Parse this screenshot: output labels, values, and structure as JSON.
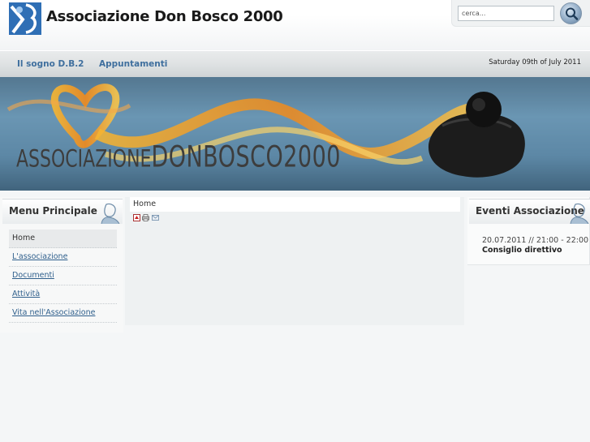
{
  "header": {
    "site_title": "Associazione Don Bosco 2000",
    "search_placeholder": "cerca..."
  },
  "nav": {
    "items": [
      {
        "label": "Il sogno D.B.2"
      },
      {
        "label": "Appuntamenti"
      }
    ],
    "date": "Saturday 09th of July 2011"
  },
  "banner": {
    "text_part1": "ASSOCIAZIONE",
    "text_part2": "DONBOSCO2000"
  },
  "left_menu": {
    "title": "Menu Principale",
    "items": [
      {
        "label": "Home",
        "active": true
      },
      {
        "label": "L'associazione"
      },
      {
        "label": "Documenti"
      },
      {
        "label": "Attività"
      },
      {
        "label": "Vita nell'Associazione"
      }
    ]
  },
  "content": {
    "breadcrumb": "Home"
  },
  "events": {
    "title": "Eventi Associazione",
    "items": [
      {
        "date": "20.07.2011 // 21:00 - 22:00",
        "title": "Consiglio direttivo"
      }
    ]
  },
  "colors": {
    "link": "#3f6f9e",
    "banner_ribbon": "#f3a020"
  },
  "icons": [
    "logo-icon",
    "search-icon",
    "pdf-icon",
    "print-icon",
    "email-icon",
    "don-bosco-portrait-icon"
  ]
}
